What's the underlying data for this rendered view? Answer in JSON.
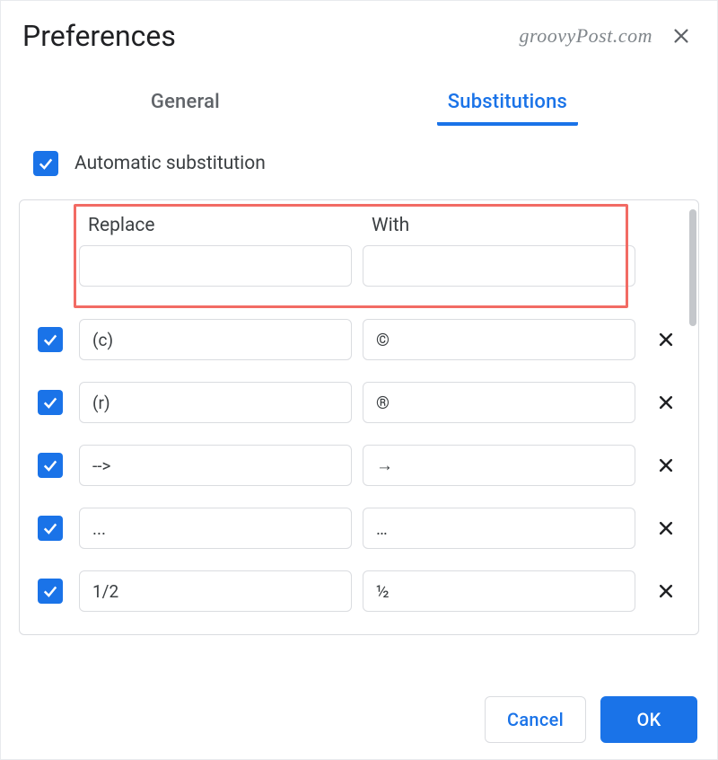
{
  "dialog": {
    "title": "Preferences",
    "watermark": "groovyPost.com"
  },
  "tabs": {
    "general": "General",
    "substitutions": "Substitutions"
  },
  "auto_substitution": {
    "label": "Automatic substitution",
    "checked": true
  },
  "columns": {
    "replace": "Replace",
    "with": "With"
  },
  "new_entry": {
    "replace": "",
    "with": ""
  },
  "substitutions": [
    {
      "checked": true,
      "replace": "(c)",
      "with": "©"
    },
    {
      "checked": true,
      "replace": "(r)",
      "with": "®"
    },
    {
      "checked": true,
      "replace": "-->",
      "with": "→"
    },
    {
      "checked": true,
      "replace": "...",
      "with": "…"
    },
    {
      "checked": true,
      "replace": "1/2",
      "with": "½"
    }
  ],
  "buttons": {
    "cancel": "Cancel",
    "ok": "OK"
  }
}
